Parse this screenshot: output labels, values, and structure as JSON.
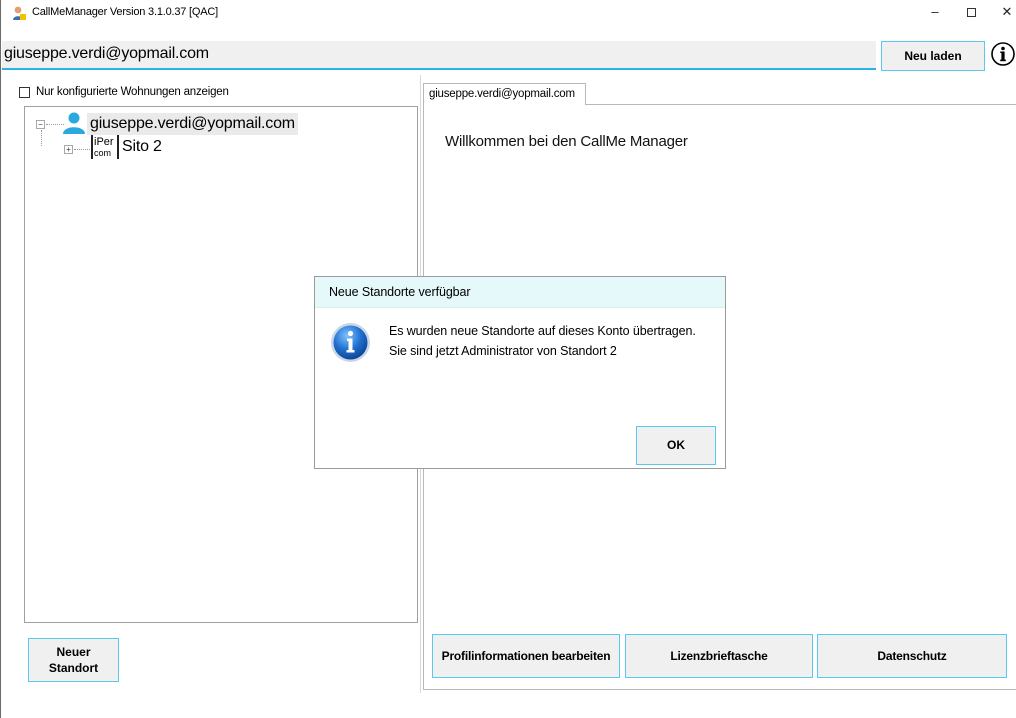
{
  "window": {
    "title": "CallMeManager Version 3.1.0.37 [QAC]",
    "minimize_glyph": "–",
    "close_glyph": "✕"
  },
  "account_bar": {
    "email": "giuseppe.verdi@yopmail.com",
    "reload_label": "Neu laden",
    "info_icon": "info-icon"
  },
  "left": {
    "filter_label": "Nur konfigurierte Wohnungen anzeigen",
    "filter_checked": false,
    "tree": {
      "root_label": "giuseppe.verdi@yopmail.com",
      "root_expander": "−",
      "child_label": "Sito 2",
      "child_expander": "+",
      "child_logo_top": "iPer",
      "child_logo_bottom": "com"
    },
    "new_site_line1": "Neuer",
    "new_site_line2": "Standort"
  },
  "right": {
    "tab_label": "giuseppe.verdi@yopmail.com",
    "welcome_text": "Willkommen bei den CallMe Manager",
    "buttons": {
      "profile": "Profilinformationen bearbeiten",
      "license": "Lizenzbrieftasche",
      "privacy": "Datenschutz"
    }
  },
  "dialog": {
    "title": "Neue Standorte verfügbar",
    "line1": "Es wurden neue Standorte auf dieses Konto übertragen.",
    "line2": "Sie sind jetzt Administrator von Standort 2",
    "ok_label": "OK",
    "icon": "info-icon"
  },
  "colors": {
    "accent": "#2ab4e6",
    "button_border": "#5ac8ef",
    "button_bg": "#f0f0f0",
    "dialog_title_bg": "#e5f8fa",
    "user_icon": "#2aa8e0"
  }
}
